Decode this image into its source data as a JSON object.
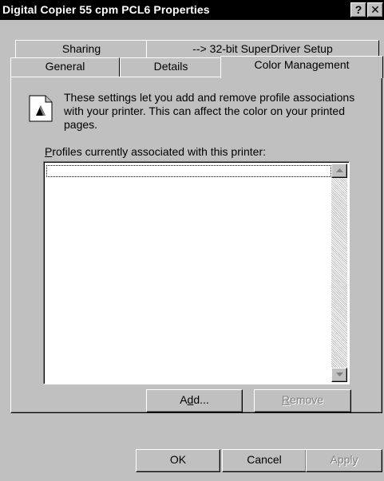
{
  "window": {
    "title": "Digital Copier 55 cpm PCL6 Properties",
    "help_label": "?",
    "close_label": "✕"
  },
  "tabs": [
    {
      "label": "Sharing",
      "active": false
    },
    {
      "label": "--> 32-bit SuperDriver Setup",
      "active": false
    },
    {
      "label": "General",
      "active": false
    },
    {
      "label": "Details",
      "active": false
    },
    {
      "label": "Color Management",
      "active": true
    }
  ],
  "color_management": {
    "icon": "document-color-profile-icon",
    "description": "These settings let you add and remove profile associations with your printer.  This can affect the color on your printed pages.",
    "list_label_accel": "P",
    "list_label_rest": "rofiles currently associated with this printer:",
    "profiles": [],
    "add_label_pre": "A",
    "add_label_accel": "d",
    "add_label_post": "d...",
    "remove_label_accel": "R",
    "remove_label_rest": "emove"
  },
  "footer": {
    "ok_label": "OK",
    "cancel_label": "Cancel",
    "apply_label": "Apply"
  },
  "colors": {
    "face": "#c0c0c0",
    "titlebar": "#000000",
    "disabled_text": "#808080"
  }
}
